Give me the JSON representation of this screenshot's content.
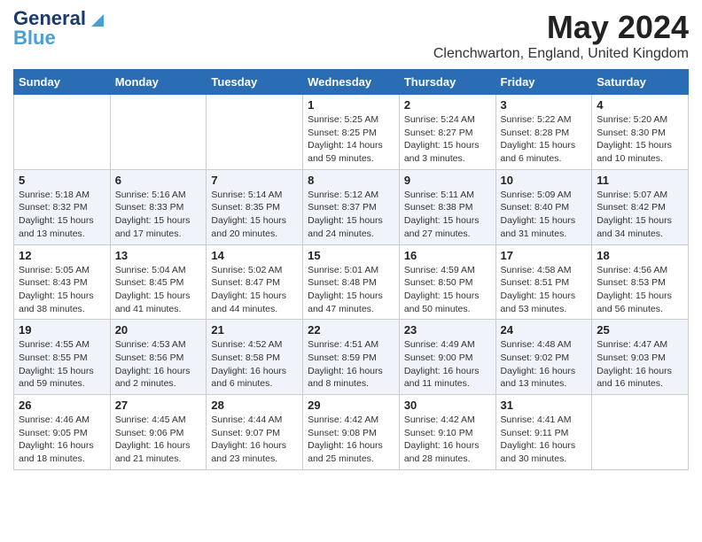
{
  "logo": {
    "line1": "General",
    "line2": "Blue"
  },
  "title": {
    "month_year": "May 2024",
    "location": "Clenchwarton, England, United Kingdom"
  },
  "days_of_week": [
    "Sunday",
    "Monday",
    "Tuesday",
    "Wednesday",
    "Thursday",
    "Friday",
    "Saturday"
  ],
  "weeks": [
    [
      {
        "day": "",
        "info": ""
      },
      {
        "day": "",
        "info": ""
      },
      {
        "day": "",
        "info": ""
      },
      {
        "day": "1",
        "info": "Sunrise: 5:25 AM\nSunset: 8:25 PM\nDaylight: 14 hours\nand 59 minutes."
      },
      {
        "day": "2",
        "info": "Sunrise: 5:24 AM\nSunset: 8:27 PM\nDaylight: 15 hours\nand 3 minutes."
      },
      {
        "day": "3",
        "info": "Sunrise: 5:22 AM\nSunset: 8:28 PM\nDaylight: 15 hours\nand 6 minutes."
      },
      {
        "day": "4",
        "info": "Sunrise: 5:20 AM\nSunset: 8:30 PM\nDaylight: 15 hours\nand 10 minutes."
      }
    ],
    [
      {
        "day": "5",
        "info": "Sunrise: 5:18 AM\nSunset: 8:32 PM\nDaylight: 15 hours\nand 13 minutes."
      },
      {
        "day": "6",
        "info": "Sunrise: 5:16 AM\nSunset: 8:33 PM\nDaylight: 15 hours\nand 17 minutes."
      },
      {
        "day": "7",
        "info": "Sunrise: 5:14 AM\nSunset: 8:35 PM\nDaylight: 15 hours\nand 20 minutes."
      },
      {
        "day": "8",
        "info": "Sunrise: 5:12 AM\nSunset: 8:37 PM\nDaylight: 15 hours\nand 24 minutes."
      },
      {
        "day": "9",
        "info": "Sunrise: 5:11 AM\nSunset: 8:38 PM\nDaylight: 15 hours\nand 27 minutes."
      },
      {
        "day": "10",
        "info": "Sunrise: 5:09 AM\nSunset: 8:40 PM\nDaylight: 15 hours\nand 31 minutes."
      },
      {
        "day": "11",
        "info": "Sunrise: 5:07 AM\nSunset: 8:42 PM\nDaylight: 15 hours\nand 34 minutes."
      }
    ],
    [
      {
        "day": "12",
        "info": "Sunrise: 5:05 AM\nSunset: 8:43 PM\nDaylight: 15 hours\nand 38 minutes."
      },
      {
        "day": "13",
        "info": "Sunrise: 5:04 AM\nSunset: 8:45 PM\nDaylight: 15 hours\nand 41 minutes."
      },
      {
        "day": "14",
        "info": "Sunrise: 5:02 AM\nSunset: 8:47 PM\nDaylight: 15 hours\nand 44 minutes."
      },
      {
        "day": "15",
        "info": "Sunrise: 5:01 AM\nSunset: 8:48 PM\nDaylight: 15 hours\nand 47 minutes."
      },
      {
        "day": "16",
        "info": "Sunrise: 4:59 AM\nSunset: 8:50 PM\nDaylight: 15 hours\nand 50 minutes."
      },
      {
        "day": "17",
        "info": "Sunrise: 4:58 AM\nSunset: 8:51 PM\nDaylight: 15 hours\nand 53 minutes."
      },
      {
        "day": "18",
        "info": "Sunrise: 4:56 AM\nSunset: 8:53 PM\nDaylight: 15 hours\nand 56 minutes."
      }
    ],
    [
      {
        "day": "19",
        "info": "Sunrise: 4:55 AM\nSunset: 8:55 PM\nDaylight: 15 hours\nand 59 minutes."
      },
      {
        "day": "20",
        "info": "Sunrise: 4:53 AM\nSunset: 8:56 PM\nDaylight: 16 hours\nand 2 minutes."
      },
      {
        "day": "21",
        "info": "Sunrise: 4:52 AM\nSunset: 8:58 PM\nDaylight: 16 hours\nand 6 minutes."
      },
      {
        "day": "22",
        "info": "Sunrise: 4:51 AM\nSunset: 8:59 PM\nDaylight: 16 hours\nand 8 minutes."
      },
      {
        "day": "23",
        "info": "Sunrise: 4:49 AM\nSunset: 9:00 PM\nDaylight: 16 hours\nand 11 minutes."
      },
      {
        "day": "24",
        "info": "Sunrise: 4:48 AM\nSunset: 9:02 PM\nDaylight: 16 hours\nand 13 minutes."
      },
      {
        "day": "25",
        "info": "Sunrise: 4:47 AM\nSunset: 9:03 PM\nDaylight: 16 hours\nand 16 minutes."
      }
    ],
    [
      {
        "day": "26",
        "info": "Sunrise: 4:46 AM\nSunset: 9:05 PM\nDaylight: 16 hours\nand 18 minutes."
      },
      {
        "day": "27",
        "info": "Sunrise: 4:45 AM\nSunset: 9:06 PM\nDaylight: 16 hours\nand 21 minutes."
      },
      {
        "day": "28",
        "info": "Sunrise: 4:44 AM\nSunset: 9:07 PM\nDaylight: 16 hours\nand 23 minutes."
      },
      {
        "day": "29",
        "info": "Sunrise: 4:42 AM\nSunset: 9:08 PM\nDaylight: 16 hours\nand 25 minutes."
      },
      {
        "day": "30",
        "info": "Sunrise: 4:42 AM\nSunset: 9:10 PM\nDaylight: 16 hours\nand 28 minutes."
      },
      {
        "day": "31",
        "info": "Sunrise: 4:41 AM\nSunset: 9:11 PM\nDaylight: 16 hours\nand 30 minutes."
      },
      {
        "day": "",
        "info": ""
      }
    ]
  ]
}
